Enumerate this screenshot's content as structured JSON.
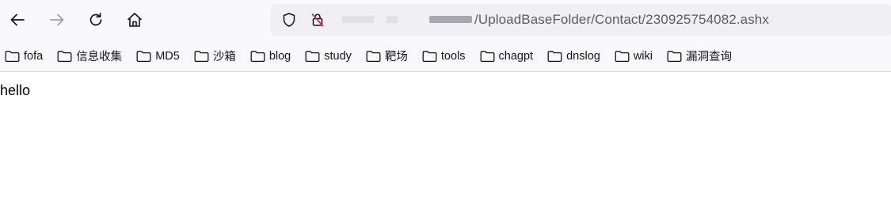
{
  "nav": {
    "back_icon": "arrow-left-icon",
    "forward_icon": "arrow-right-icon",
    "reload_icon": "reload-icon",
    "home_icon": "home-icon"
  },
  "urlbar": {
    "shield_icon": "tracking-protection-shield-icon",
    "lock_icon": "insecure-lock-icon",
    "url_visible": "/UploadBaseFolder/Contact/230925754082.ashx"
  },
  "bookmarks": [
    {
      "label": "fofa",
      "icon": "folder-icon"
    },
    {
      "label": "信息收集",
      "icon": "folder-icon"
    },
    {
      "label": "MD5",
      "icon": "folder-icon"
    },
    {
      "label": "沙箱",
      "icon": "folder-icon"
    },
    {
      "label": "blog",
      "icon": "folder-icon"
    },
    {
      "label": "study",
      "icon": "folder-icon"
    },
    {
      "label": "靶场",
      "icon": "folder-icon"
    },
    {
      "label": "tools",
      "icon": "folder-icon"
    },
    {
      "label": "chagpt",
      "icon": "folder-icon"
    },
    {
      "label": "dnslog",
      "icon": "folder-icon"
    },
    {
      "label": "wiki",
      "icon": "folder-icon"
    },
    {
      "label": "漏洞查询",
      "icon": "folder-icon"
    }
  ],
  "page": {
    "body_text": "hello"
  },
  "colors": {
    "toolbar_bg": "#f9f9fb",
    "urlbar_bg": "#f0f0f4",
    "text": "#15141a",
    "url_text": "#5b5b66",
    "lock_slash": "#e22850"
  }
}
